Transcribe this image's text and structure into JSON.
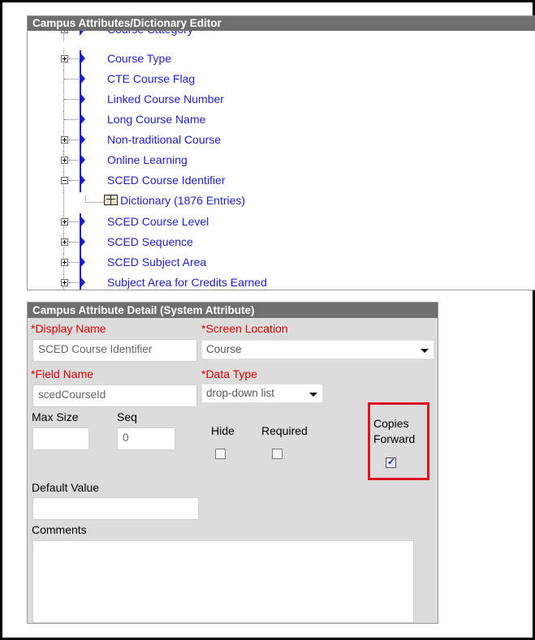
{
  "tree_panel": {
    "title": "Campus Attributes/Dictionary Editor",
    "items": [
      {
        "label": "Course Category",
        "expander": "plus"
      },
      {
        "label": "Course Type",
        "expander": "plus"
      },
      {
        "label": "CTE Course Flag",
        "expander": "none"
      },
      {
        "label": "Linked Course Number",
        "expander": "none"
      },
      {
        "label": "Long Course Name",
        "expander": "none"
      },
      {
        "label": "Non-traditional Course",
        "expander": "plus"
      },
      {
        "label": "Online Learning",
        "expander": "plus"
      },
      {
        "label": "SCED Course Identifier",
        "expander": "minus"
      },
      {
        "label": "SCED Course Level",
        "expander": "plus"
      },
      {
        "label": "SCED Sequence",
        "expander": "plus"
      },
      {
        "label": "SCED Subject Area",
        "expander": "plus"
      },
      {
        "label": "Subject Area for Credits Earned",
        "expander": "plus"
      }
    ],
    "dictionary_child": "Dictionary (1876 Entries)"
  },
  "detail": {
    "title": "Campus Attribute Detail (System Attribute)",
    "display_name_label": "*Display Name",
    "display_name_value": "SCED Course Identifier",
    "screen_location_label": "*Screen Location",
    "screen_location_value": "Course",
    "field_name_label": "*Field Name",
    "field_name_value": "scedCourseId",
    "data_type_label": "*Data Type",
    "data_type_value": "drop-down list",
    "max_size_label": "Max Size",
    "max_size_value": "",
    "seq_label": "Seq",
    "seq_value": "0",
    "hide_label": "Hide",
    "hide_checked": false,
    "required_label": "Required",
    "required_checked": false,
    "copies_forward_label_1": "Copies",
    "copies_forward_label_2": "Forward",
    "copies_forward_checked": true,
    "default_value_label": "Default Value",
    "default_value": "",
    "comments_label": "Comments",
    "comments_value": ""
  },
  "colors": {
    "link": "#1f1fcc",
    "header_bg": "#6f6f6f",
    "required_label": "#d90000",
    "highlight": "#e0141e",
    "panel_bg": "#dcdcdc"
  }
}
